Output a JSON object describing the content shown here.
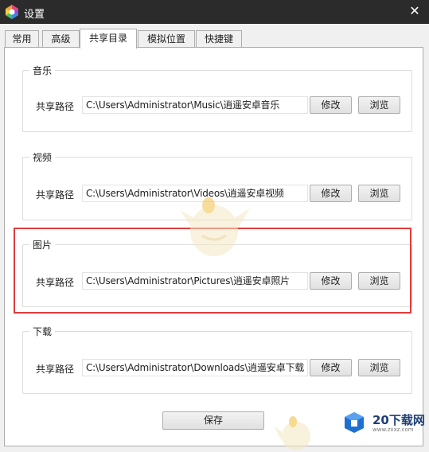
{
  "window": {
    "title": "设置",
    "close_glyph": "✕"
  },
  "tabs": [
    {
      "label": "常用",
      "active": false
    },
    {
      "label": "高级",
      "active": false
    },
    {
      "label": "共享目录",
      "active": true
    },
    {
      "label": "模拟位置",
      "active": false
    },
    {
      "label": "快捷键",
      "active": false
    }
  ],
  "groups": [
    {
      "title": "音乐",
      "path_label": "共享路径",
      "path_value": "C:\\Users\\Administrator\\Music\\逍遥安卓音乐",
      "modify_label": "修改",
      "browse_label": "浏览"
    },
    {
      "title": "视频",
      "path_label": "共享路径",
      "path_value": "C:\\Users\\Administrator\\Videos\\逍遥安卓视频",
      "modify_label": "修改",
      "browse_label": "浏览"
    },
    {
      "title": "图片",
      "path_label": "共享路径",
      "path_value": "C:\\Users\\Administrator\\Pictures\\逍遥安卓照片",
      "modify_label": "修改",
      "browse_label": "浏览"
    },
    {
      "title": "下载",
      "path_label": "共享路径",
      "path_value": "C:\\Users\\Administrator\\Downloads\\逍遥安卓下载",
      "modify_label": "修改",
      "browse_label": "浏览"
    }
  ],
  "save_label": "保存",
  "watermark": {
    "brand": "20下载网",
    "url": "www.zxxz.com"
  },
  "colors": {
    "titlebar": "#2b2b2b",
    "highlight": "#e03c3c",
    "panel": "#ffffff"
  }
}
